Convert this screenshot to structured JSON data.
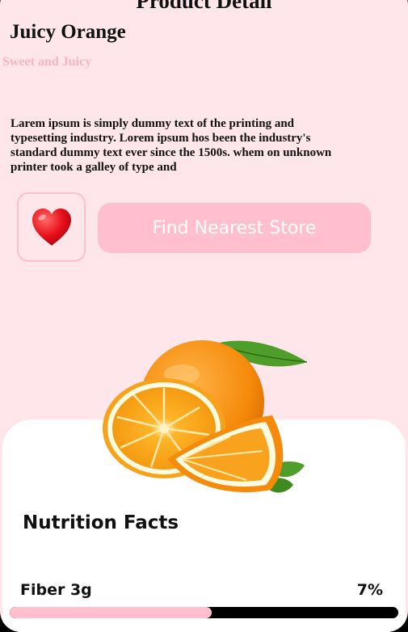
{
  "header": {
    "title": "Product Detail"
  },
  "product": {
    "name": "Juicy Orange",
    "tagline": "Sweet and Juicy",
    "description": "Larem ipsum is simply dummy text of the printing and typesetting industry. Lorem ipsum hos been the industry's standard dummy text ever since the 1500s. whem on unknown printer took a galley of type and"
  },
  "actions": {
    "favorite_icon": "heart-icon",
    "store_button_label": "Find Nearest Store"
  },
  "nutrition": {
    "title": "Nutrition Facts",
    "items": [
      {
        "label": "Fiber 3g",
        "percent_label": "7%",
        "fill_fraction": 0.52
      }
    ]
  },
  "colors": {
    "background": "#ffe6ea",
    "accent": "#ffbfcf",
    "heart": "#e8101a",
    "progress_track": "#000000"
  }
}
